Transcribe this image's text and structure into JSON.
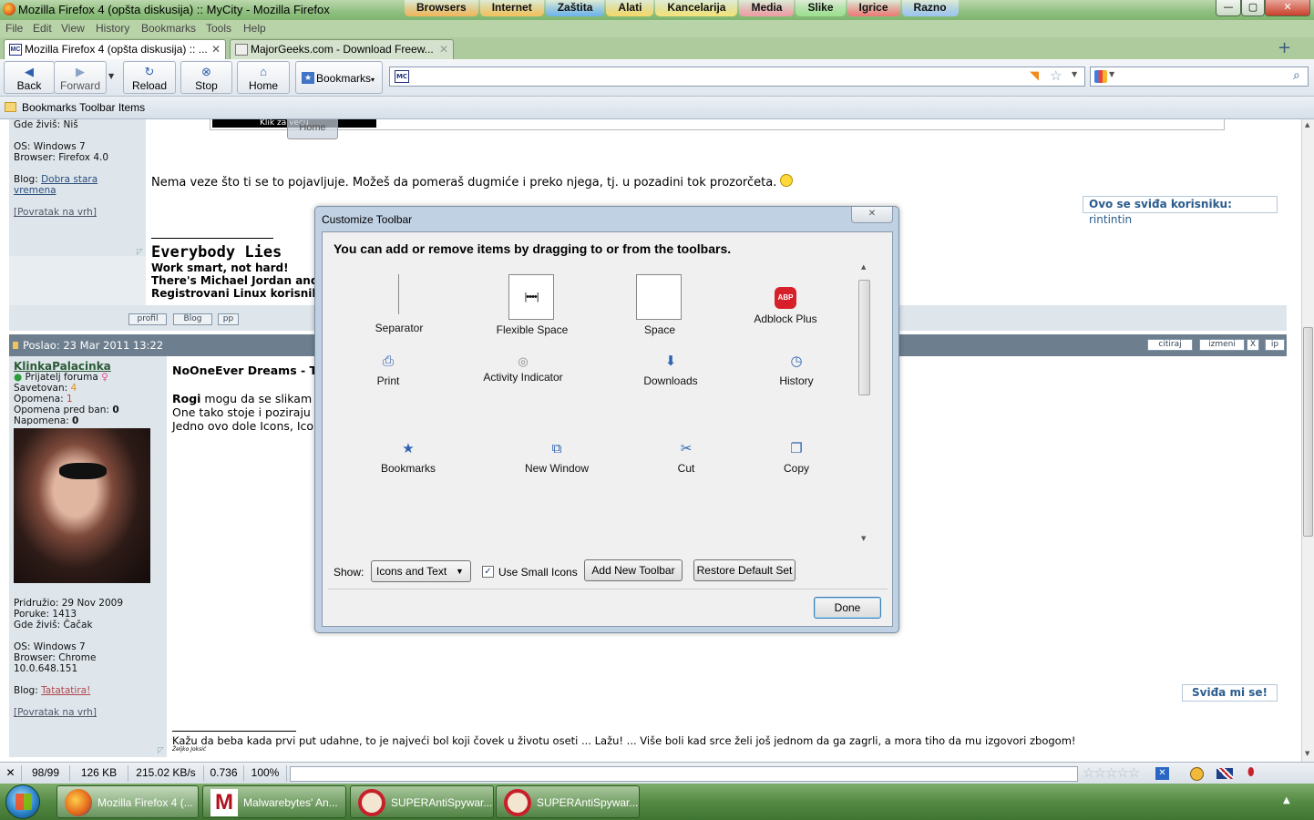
{
  "window": {
    "title": "Mozilla Firefox 4 (opšta diskusija) :: MyCity - Mozilla Firefox",
    "quick_tabs": [
      {
        "label": "Browsers",
        "color": "#f2b55a"
      },
      {
        "label": "Internet",
        "color": "#f5c15c"
      },
      {
        "label": "Zaštita",
        "color": "#6fb3f0"
      },
      {
        "label": "Alati",
        "color": "#f7d768"
      },
      {
        "label": "Kancelarija",
        "color": "#f6e27a"
      },
      {
        "label": "Media",
        "color": "#f09aa6"
      },
      {
        "label": "Slike",
        "color": "#9be08f"
      },
      {
        "label": "Igrice",
        "color": "#ef7777"
      },
      {
        "label": "Razno",
        "color": "#9cc4f3"
      }
    ],
    "controls": {
      "minimize": "—",
      "maximize": "▢",
      "close": "✕"
    }
  },
  "menu": [
    "File",
    "Edit",
    "View",
    "History",
    "Bookmarks",
    "Tools",
    "Help"
  ],
  "tabs": [
    {
      "label": "Mozilla Firefox 4 (opšta diskusija) :: ...",
      "close": "✕",
      "favicon": "MC"
    },
    {
      "label": "MajorGeeks.com - Download Freew...",
      "close": "✕"
    }
  ],
  "new_tab": "+",
  "navbar": {
    "back": "Back",
    "forward": "Forward",
    "reload": "Reload",
    "stop": "Stop",
    "home": "Home",
    "bookmarks": "Bookmarks",
    "url_favicon": "MC"
  },
  "bookmarks_toolbar": {
    "label": "Bookmarks Toolbar Items"
  },
  "page": {
    "post1_side": {
      "location": "Gde živiš: Niš",
      "os": "OS: Windows 7",
      "browser": "Browser: Firefox 4.0",
      "blog_prefix": "Blog: ",
      "blog_link": "Dobra stara vremena",
      "top_link": "[Povratak na vrh]"
    },
    "banner_text": "Klik za veću",
    "home_ghost": "Home",
    "post1_text": "Nema veze što ti se to pojavljuje. Možeš da pomeraš dugmiće i preko njega, tj. u pozadini tok prozorčeta.",
    "likes_prefix": "Ovo se sviđa korisniku:",
    "likes_user": "rintintin",
    "sig1": {
      "title": "Everybody Lies",
      "line1": "Work smart, not hard!",
      "line2": "There's Michael Jordan and",
      "line3": "Registrovani Linux korisnik"
    },
    "profile_buttons": [
      "profil",
      "Blog",
      "pp"
    ],
    "post2_header": "Poslao: 23 Mar 2011 13:22",
    "post2_buttons": [
      "citiraj",
      "izmeni",
      "X",
      "ip"
    ],
    "user2": {
      "name": "KlinkaPalacinka",
      "rank": "Prijatelj foruma",
      "warned_label": "Savetovan:",
      "warned": "4",
      "warnings_label": "Opomena:",
      "warnings": "1",
      "preban_label": "Opomena pred ban:",
      "preban": "0",
      "notes_label": "Napomena:",
      "notes": "0",
      "joined": "Pridružio: 29 Nov 2009",
      "posts": "Poruke: 1413",
      "location": "Gde živiš: Čačak",
      "os": "OS: Windows 7",
      "browser": "Browser: Chrome 10.0.648.151",
      "blog_prefix": "Blog: ",
      "blog_link": "Tatatatira!",
      "top_link": "[Povratak na vrh]"
    },
    "post2": {
      "title": "NoOneEver Dreams - To",
      "line1_bold": "Rogi",
      "line1_rest": " mogu da se slikam",
      "line2": "One tako stoje i poziraju",
      "line3": "Jedno ovo dole Icons, Ico"
    },
    "like_button": "Sviđa mi se!",
    "sig2": "Kažu da beba kada prvi put udahne, to je najveći bol koji čovek u životu oseti ... Lažu! ... Više boli kad srce želi još jednom da ga zagrli, a mora tiho da mu izgovori zbogom!",
    "sig2_author": "Željko Joksić"
  },
  "dialog": {
    "title": "Customize Toolbar",
    "instruction": "You can add or remove items by dragging to or from the toolbars.",
    "items": [
      {
        "label": "Separator",
        "icon": "separator-icon"
      },
      {
        "label": "Flexible Space",
        "icon": "flexible-space-icon"
      },
      {
        "label": "Space",
        "icon": "space-icon"
      },
      {
        "label": "Adblock Plus",
        "icon": "adblock-icon"
      },
      {
        "label": "Print",
        "icon": "printer-icon"
      },
      {
        "label": "Activity Indicator",
        "icon": "throbber-icon"
      },
      {
        "label": "Downloads",
        "icon": "download-icon"
      },
      {
        "label": "History",
        "icon": "clock-icon"
      },
      {
        "label": "Bookmarks",
        "icon": "star-icon"
      },
      {
        "label": "New Window",
        "icon": "new-window-icon"
      },
      {
        "label": "Cut",
        "icon": "scissors-icon"
      },
      {
        "label": "Copy",
        "icon": "copy-icon"
      }
    ],
    "show_label": "Show:",
    "show_value": "Icons and Text",
    "small_icons_label": "Use Small Icons",
    "small_icons_checked": true,
    "add_toolbar": "Add New Toolbar",
    "restore": "Restore Default Set",
    "done": "Done",
    "abp": "ABP"
  },
  "status": {
    "close": "✕",
    "pages": "98/99",
    "size": "126 KB",
    "speed": "215.02 KB/s",
    "time": "0.736",
    "zoom": "100%"
  },
  "taskbar": [
    {
      "label": "Mozilla Firefox 4 (..."
    },
    {
      "label": "Malwarebytes' An..."
    },
    {
      "label": "SUPERAntiSpywar..."
    },
    {
      "label": "SUPERAntiSpywar..."
    }
  ],
  "tray": "▲"
}
